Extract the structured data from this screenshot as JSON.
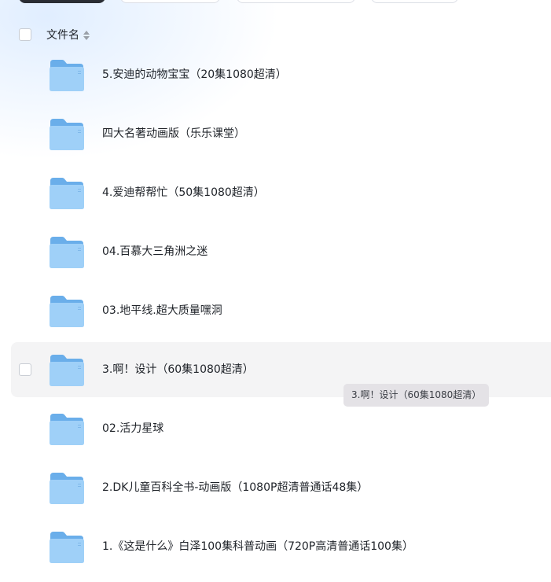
{
  "header": {
    "column_label": "文件名",
    "sort_icon": "sort-icon"
  },
  "files": [
    {
      "name": "5.安迪的动物宝宝（20集1080超清）",
      "icon": "folder-icon"
    },
    {
      "name": "四大名著动画版（乐乐课堂）",
      "icon": "folder-icon"
    },
    {
      "name": "4.爱迪帮帮忙（50集1080超清）",
      "icon": "folder-icon"
    },
    {
      "name": "04.百慕大三角洲之迷",
      "icon": "folder-icon"
    },
    {
      "name": "03.地平线.超大质量嘿洞",
      "icon": "folder-icon"
    },
    {
      "name": "3.啊！设计（60集1080超清）",
      "icon": "folder-icon",
      "hovered": true
    },
    {
      "name": "02.活力星球",
      "icon": "folder-icon"
    },
    {
      "name": "2.DK儿童百科全书-动画版（1080P超清普通话48集）",
      "icon": "folder-icon"
    },
    {
      "name": "1.《这是什么》白泽100集科普动画（720P高清普通话100集）",
      "icon": "folder-icon"
    }
  ],
  "tooltip": {
    "text": "3.啊！设计（60集1080超清）"
  },
  "colors": {
    "folder_back": "#6aaeea",
    "folder_front": "#9fd0f8",
    "hover_row": "#f4f4f5",
    "tooltip_bg": "#e4e2e6"
  }
}
